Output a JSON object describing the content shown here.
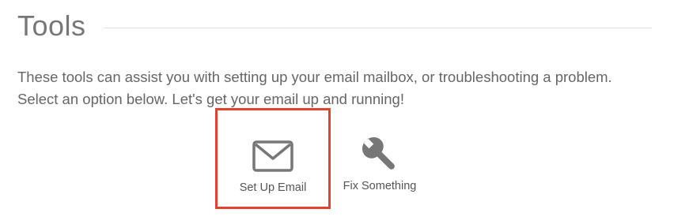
{
  "section": {
    "title": "Tools"
  },
  "intro": {
    "text": "These tools can assist you with setting up your email mailbox, or troubleshooting a problem. Select an option below. Let's get your email up and running!"
  },
  "tools": [
    {
      "label": "Set Up Email",
      "icon": "envelope-icon",
      "selected": true,
      "highlight_color": "#e0432e"
    },
    {
      "label": "Fix Something",
      "icon": "wrench-icon",
      "selected": false
    }
  ],
  "colors": {
    "text": "#666666",
    "icon": "#777777",
    "highlight": "#e0432e",
    "rule": "#dddddd"
  }
}
